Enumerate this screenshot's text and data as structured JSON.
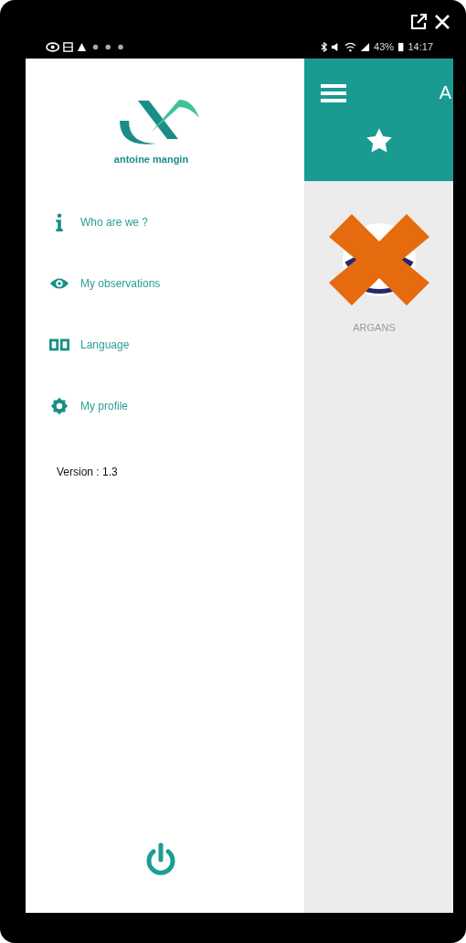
{
  "status_bar": {
    "battery": "43%",
    "time": "14:17"
  },
  "drawer": {
    "logo_text": "antoine mangin",
    "items": [
      {
        "kind": "info",
        "label": "Who are we ?"
      },
      {
        "kind": "eye",
        "label": "My observations"
      },
      {
        "kind": "language",
        "label": "Language"
      },
      {
        "kind": "gear",
        "label": "My profile"
      }
    ],
    "version": "Version : 1.3"
  },
  "app_bar": {
    "title": "A"
  },
  "cards": [
    {
      "label": "ARGANS",
      "crossed": true
    }
  ]
}
